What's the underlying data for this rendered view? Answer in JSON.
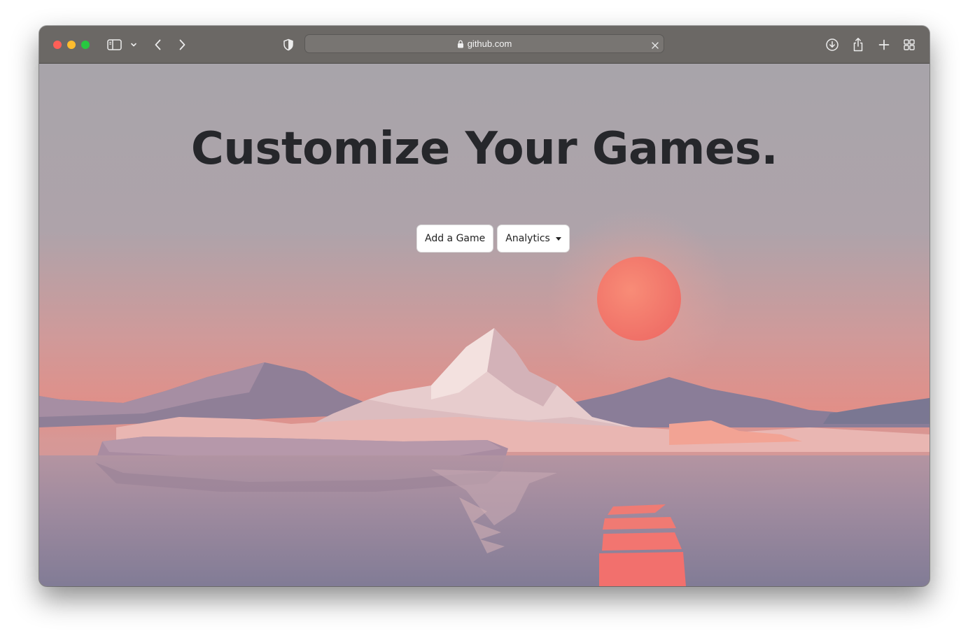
{
  "browser": {
    "url": "github.com",
    "toolbar_icons": [
      "sidebar-icon",
      "chevron-down-icon",
      "back-icon",
      "forward-icon",
      "shield-icon",
      "lock-icon",
      "close-icon",
      "download-icon",
      "share-icon",
      "new-tab-icon",
      "tab-overview-icon"
    ]
  },
  "page": {
    "headline": "Customize Your Games.",
    "buttons": {
      "add_game": "Add a Game",
      "analytics": "Analytics"
    }
  },
  "colors": {
    "toolbar": "#6b6865",
    "sky_top": "#a9a4a9",
    "sun": "#f2776c",
    "water": "#a0879b"
  }
}
